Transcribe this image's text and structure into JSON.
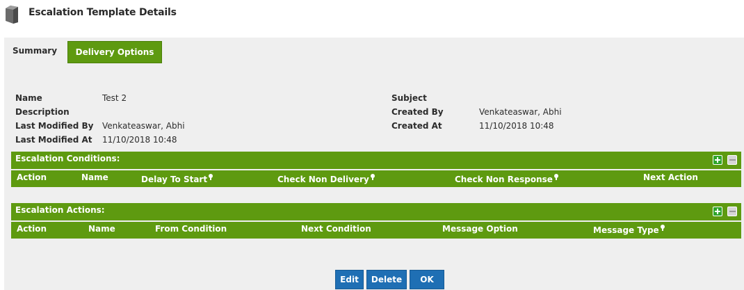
{
  "header": {
    "title": "Escalation Template Details",
    "icon": "template-icon"
  },
  "tabs": {
    "summary": "Summary",
    "delivery_options": "Delivery Options",
    "active": "delivery_options"
  },
  "details": {
    "name_label": "Name",
    "name_value": "Test 2",
    "description_label": "Description",
    "description_value": "",
    "last_modified_by_label": "Last Modified By",
    "last_modified_by_value": "Venkateaswar, Abhi",
    "last_modified_at_label": "Last Modified At",
    "last_modified_at_value": "11/10/2018 10:48",
    "subject_label": "Subject",
    "subject_value": "",
    "created_by_label": "Created By",
    "created_by_value": "Venkateaswar, Abhi",
    "created_at_label": "Created At",
    "created_at_value": "11/10/2018 10:48"
  },
  "conditions": {
    "title": "Escalation Conditions:",
    "columns": [
      "Action",
      "Name",
      "Delay To Start",
      "Check Non Delivery",
      "Check Non Response",
      "Next Action"
    ]
  },
  "actions": {
    "title": "Escalation Actions:",
    "columns": [
      "Action",
      "Name",
      "From Condition",
      "Next Condition",
      "Message Option",
      "Message Type"
    ]
  },
  "buttons": {
    "edit": "Edit",
    "delete": "Delete",
    "ok": "OK"
  },
  "colors": {
    "accent_green": "#5e9a10",
    "button_blue": "#1f6fb4",
    "panel_bg": "#efefef"
  }
}
